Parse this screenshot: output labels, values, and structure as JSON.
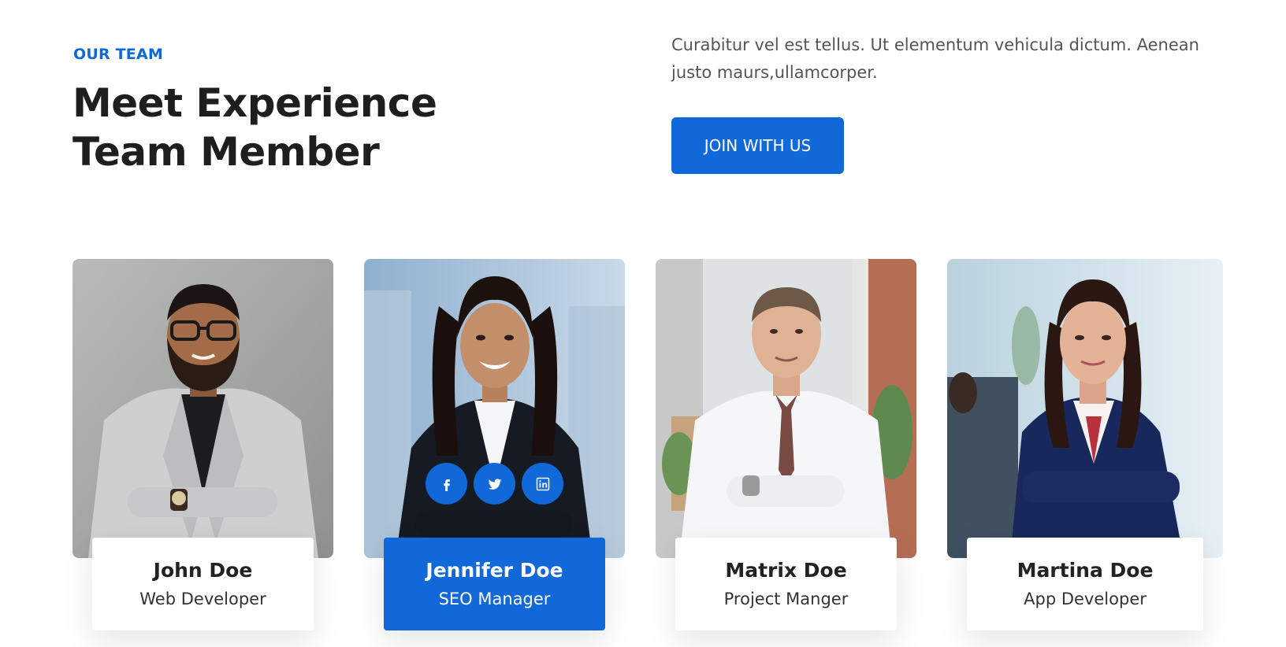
{
  "header": {
    "eyebrow": "OUR TEAM",
    "title_line1": "Meet Experience",
    "title_line2": "Team Member",
    "intro": "Curabitur vel est tellus. Ut elementum vehicula dictum. Aenean justo maurs,ullamcorper.",
    "cta_label": "JOIN WITH US"
  },
  "team": [
    {
      "name": "John Doe",
      "role": "Web Developer"
    },
    {
      "name": "Jennifer Doe",
      "role": "SEO Manager"
    },
    {
      "name": "Matrix Doe",
      "role": "Project Manger"
    },
    {
      "name": "Martina Doe",
      "role": "App Developer"
    }
  ],
  "socials": [
    "facebook-icon",
    "twitter-icon",
    "linkedin-icon"
  ],
  "colors": {
    "accent": "#1168d9",
    "text": "#222222",
    "muted": "#555555"
  }
}
